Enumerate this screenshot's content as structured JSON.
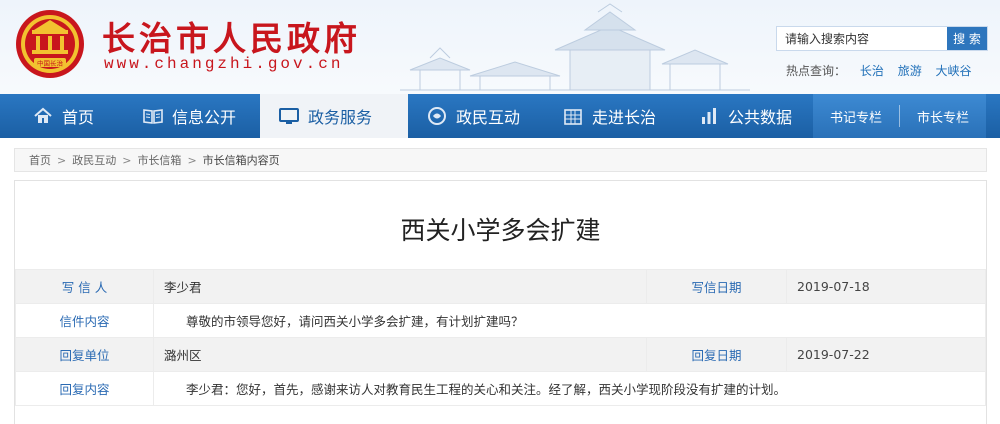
{
  "header": {
    "site_title": "长治市人民政府",
    "site_url": "www.changzhi.gov.cn",
    "emblem_text": "中国长治",
    "search": {
      "placeholder": "请输入搜索内容",
      "button": "搜 索"
    },
    "hot": {
      "label": "热点查询：",
      "links": [
        "长治",
        "旅游",
        "大峡谷"
      ]
    }
  },
  "nav": {
    "items": [
      {
        "label": "首页",
        "icon": "home-icon"
      },
      {
        "label": "信息公开",
        "icon": "book-icon"
      },
      {
        "label": "政务服务",
        "icon": "monitor-icon"
      },
      {
        "label": "政民互动",
        "icon": "chat-icon"
      },
      {
        "label": "走进长治",
        "icon": "building-icon"
      },
      {
        "label": "公共数据",
        "icon": "bar-chart-icon"
      }
    ],
    "active_index": 2,
    "special": [
      "书记专栏",
      "市长专栏"
    ]
  },
  "breadcrumb": {
    "items": [
      "首页",
      "政民互动",
      "市长信箱"
    ],
    "current": "市长信箱内容页",
    "separator": ">"
  },
  "letter": {
    "title": "西关小学多会扩建",
    "writer_label": "写 信 人",
    "writer": "李少君",
    "write_date_label": "写信日期",
    "write_date": "2019-07-18",
    "content_label": "信件内容",
    "content": "尊敬的市领导您好，请问西关小学多会扩建，有计划扩建吗？",
    "reply_unit_label": "回复单位",
    "reply_unit": "潞州区",
    "reply_date_label": "回复日期",
    "reply_date": "2019-07-22",
    "reply_content_label": "回复内容",
    "reply_content": "李少君：您好，首先，感谢来访人对教育民生工程的关心和关注。经了解，西关小学现阶段没有扩建的计划。"
  },
  "colors": {
    "brand_red": "#c8161d",
    "nav_blue": "#1b5fa4",
    "label_blue": "#2a6ab3"
  }
}
